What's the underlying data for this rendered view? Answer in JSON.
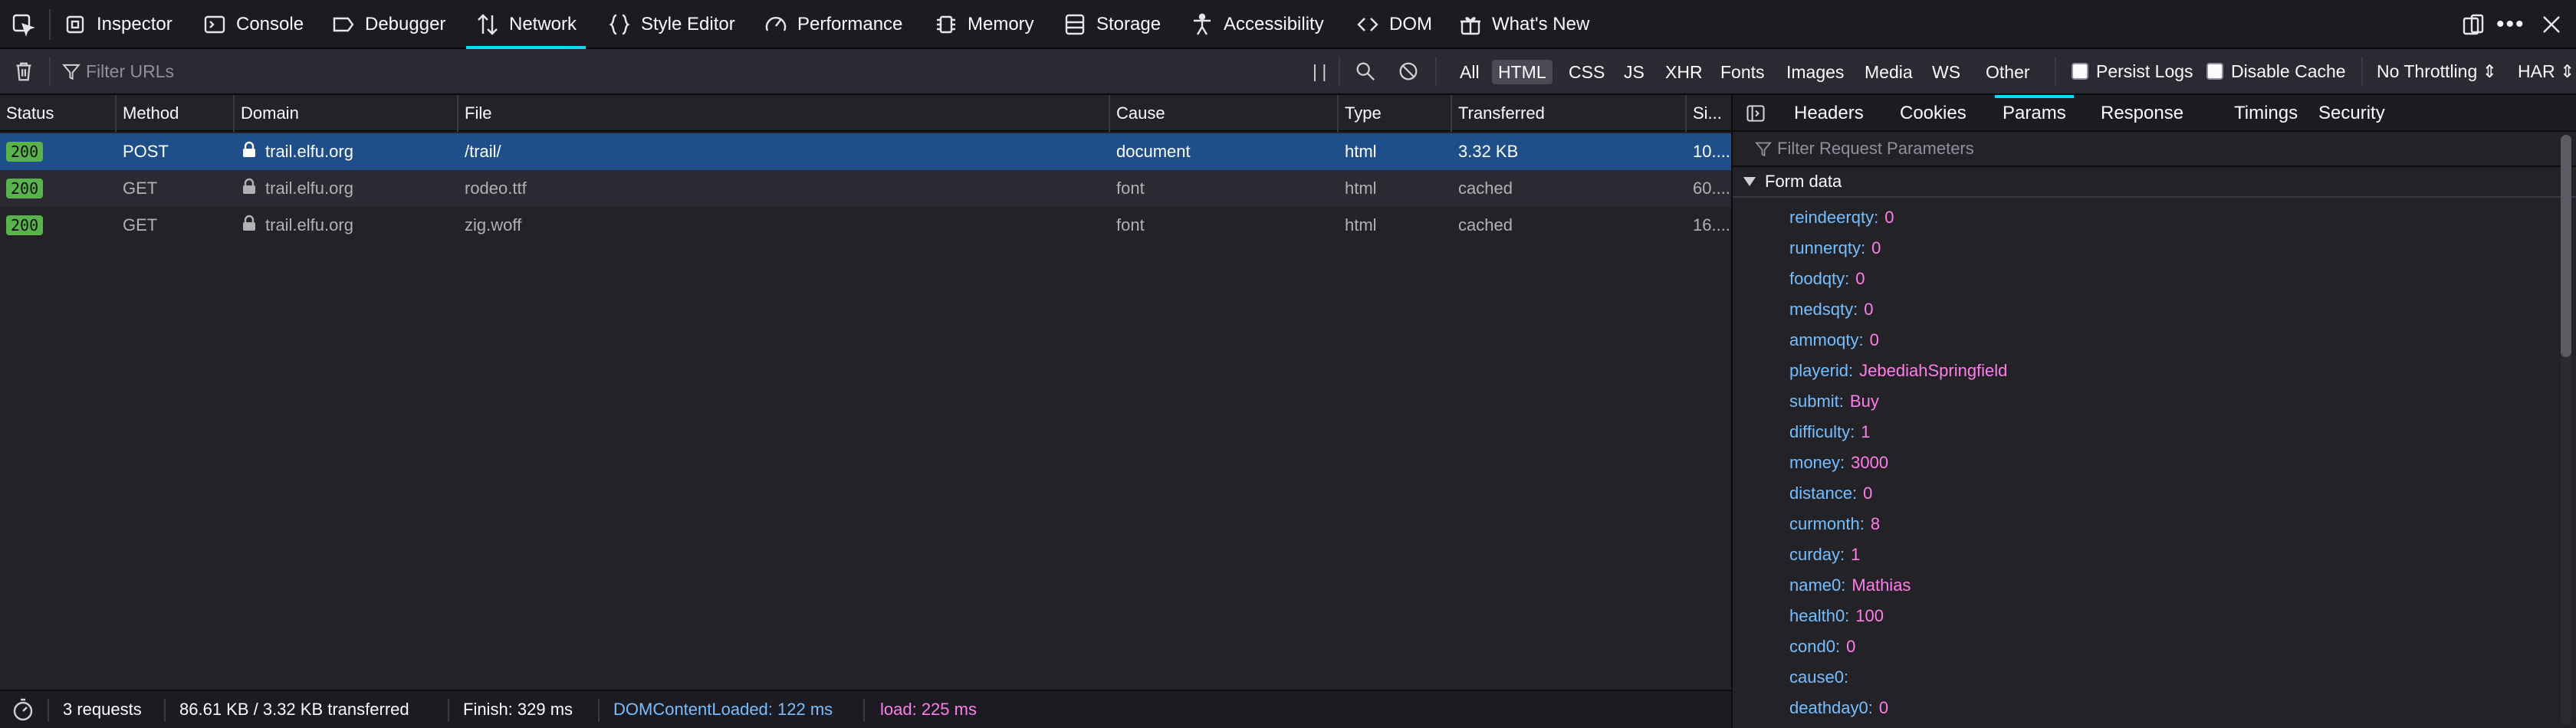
{
  "toolbar": {
    "tools": [
      "Inspector",
      "Console",
      "Debugger",
      "Network",
      "Style Editor",
      "Performance",
      "Memory",
      "Storage",
      "Accessibility",
      "DOM",
      "What's New"
    ],
    "selected": "Network"
  },
  "filterbar": {
    "filter_placeholder": "Filter URLs",
    "pause_label": "| |",
    "types": [
      "All",
      "HTML",
      "CSS",
      "JS",
      "XHR",
      "Fonts",
      "Images",
      "Media",
      "WS",
      "Other"
    ],
    "active_type": "HTML",
    "persist_logs": "Persist Logs",
    "disable_cache": "Disable Cache",
    "throttling": "No Throttling ⇕",
    "har": "HAR ⇕"
  },
  "table": {
    "columns": [
      "Status",
      "Method",
      "Domain",
      "File",
      "Cause",
      "Type",
      "Transferred",
      "Si..."
    ],
    "rows": [
      {
        "status": "200",
        "method": "POST",
        "domain": "trail.elfu.org",
        "file": "/trail/",
        "cause": "document",
        "type": "html",
        "transferred": "3.32 KB",
        "size": "10...."
      },
      {
        "status": "200",
        "method": "GET",
        "domain": "trail.elfu.org",
        "file": "rodeo.ttf",
        "cause": "font",
        "type": "html",
        "transferred": "cached",
        "size": "60...."
      },
      {
        "status": "200",
        "method": "GET",
        "domain": "trail.elfu.org",
        "file": "zig.woff",
        "cause": "font",
        "type": "html",
        "transferred": "cached",
        "size": "16...."
      }
    ]
  },
  "statusbar": {
    "requests": "3 requests",
    "transferred": "86.61 KB / 3.32 KB transferred",
    "finish": "Finish: 329 ms",
    "domcontentloaded": "DOMContentLoaded: 122 ms",
    "load": "load: 225 ms"
  },
  "panel": {
    "tabs": [
      "Headers",
      "Cookies",
      "Params",
      "Response",
      "Timings",
      "Security"
    ],
    "selected_tab": "Params",
    "filter_placeholder": "Filter Request Parameters",
    "section_title": "Form data",
    "params": [
      {
        "key": "reindeerqty:",
        "value": "0"
      },
      {
        "key": "runnerqty:",
        "value": "0"
      },
      {
        "key": "foodqty:",
        "value": "0"
      },
      {
        "key": "medsqty:",
        "value": "0"
      },
      {
        "key": "ammoqty:",
        "value": "0"
      },
      {
        "key": "playerid:",
        "value": "JebediahSpringfield"
      },
      {
        "key": "submit:",
        "value": "Buy"
      },
      {
        "key": "difficulty:",
        "value": "1"
      },
      {
        "key": "money:",
        "value": "3000"
      },
      {
        "key": "distance:",
        "value": "0"
      },
      {
        "key": "curmonth:",
        "value": "8"
      },
      {
        "key": "curday:",
        "value": "1"
      },
      {
        "key": "name0:",
        "value": "Mathias"
      },
      {
        "key": "health0:",
        "value": "100"
      },
      {
        "key": "cond0:",
        "value": "0"
      },
      {
        "key": "cause0:",
        "value": ""
      },
      {
        "key": "deathday0:",
        "value": "0"
      }
    ]
  },
  "colors": {
    "accent": "#00ddff",
    "selected_row": "#1f4f8a",
    "param_key": "#75bfff",
    "param_value": "#ff7de9",
    "status_ok": "#58b34a"
  }
}
